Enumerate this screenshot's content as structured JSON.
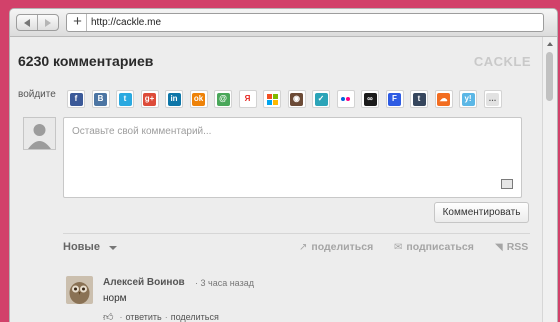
{
  "browser": {
    "url": "http://cackle.me"
  },
  "widget": {
    "title": "6230 комментариев",
    "brand": "CACKLE",
    "login_label": "войдите",
    "providers": [
      {
        "name": "facebook-icon",
        "glyph": "f",
        "color": "#3b5998"
      },
      {
        "name": "vkontakte-icon",
        "glyph": "B",
        "color": "#4c75a3"
      },
      {
        "name": "twitter-icon",
        "glyph": "t",
        "color": "#2aa9e0"
      },
      {
        "name": "google-plus-icon",
        "glyph": "g+",
        "color": "#dd4b39"
      },
      {
        "name": "linkedin-icon",
        "glyph": "in",
        "color": "#0e76a8"
      },
      {
        "name": "odnoklassniki-icon",
        "glyph": "ok",
        "color": "#ee8208"
      },
      {
        "name": "mailru-icon",
        "glyph": "@",
        "color": "#4aa75a"
      },
      {
        "name": "yandex-icon",
        "glyph": "Я",
        "color": "#ffffff"
      },
      {
        "name": "microsoft-icon",
        "glyph": "",
        "color": "#ffffff"
      },
      {
        "name": "instagram-icon",
        "glyph": "◉",
        "color": "#6b4a36"
      },
      {
        "name": "checkin-icon",
        "glyph": "✓",
        "color": "#2ba4b8"
      },
      {
        "name": "flickr-icon",
        "glyph": "●●",
        "color": "#ffffff"
      },
      {
        "name": "lastfm-icon",
        "glyph": "∞",
        "color": "#1a1a1a"
      },
      {
        "name": "foursquare-icon",
        "glyph": "F",
        "color": "#2d5be3"
      },
      {
        "name": "tumblr-icon",
        "glyph": "t",
        "color": "#36465d"
      },
      {
        "name": "soundcloud-icon",
        "glyph": "☁",
        "color": "#f26d21"
      },
      {
        "name": "yahoo-icon",
        "glyph": "y!",
        "color": "#5bb7e6"
      },
      {
        "name": "more-icon",
        "glyph": "…",
        "color": "#e2e2e2"
      }
    ],
    "comment_placeholder": "Оставьте свой комментарий...",
    "submit_label": "Комментировать",
    "sort_label": "Новые",
    "share_label": "поделиться",
    "subscribe_label": "подписаться",
    "rss_label": "RSS"
  },
  "comments": [
    {
      "author": "Алексей Воинов",
      "time": "· 3 часа назад",
      "text": "норм",
      "reply_label": "ответить",
      "share_label": "поделиться"
    }
  ]
}
